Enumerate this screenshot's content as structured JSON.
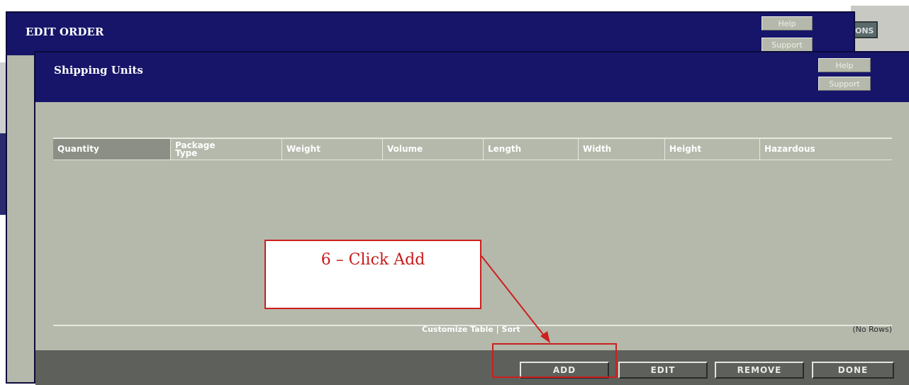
{
  "background": {
    "partial_button_label": "ONS"
  },
  "outer_dialog": {
    "title": "EDIT ORDER",
    "help_label": "Help",
    "support_label": "Support"
  },
  "inner_dialog": {
    "title": "Shipping Units",
    "help_label": "Help",
    "support_label": "Support"
  },
  "table": {
    "columns": [
      {
        "label": "Quantity"
      },
      {
        "label": "Package Type"
      },
      {
        "label": "Weight"
      },
      {
        "label": "Volume"
      },
      {
        "label": "Length"
      },
      {
        "label": "Width"
      },
      {
        "label": "Height"
      },
      {
        "label": "Hazardous"
      }
    ],
    "rows": [],
    "customize_label": "Customize Table",
    "separator": "|",
    "sort_label": "Sort",
    "empty_label": "(No Rows)"
  },
  "actions": {
    "add_label": "ADD",
    "edit_label": "EDIT",
    "remove_label": "REMOVE",
    "done_label": "DONE"
  },
  "annotation": {
    "callout_text": "6 – Click Add",
    "color": "#cc1f1f"
  }
}
